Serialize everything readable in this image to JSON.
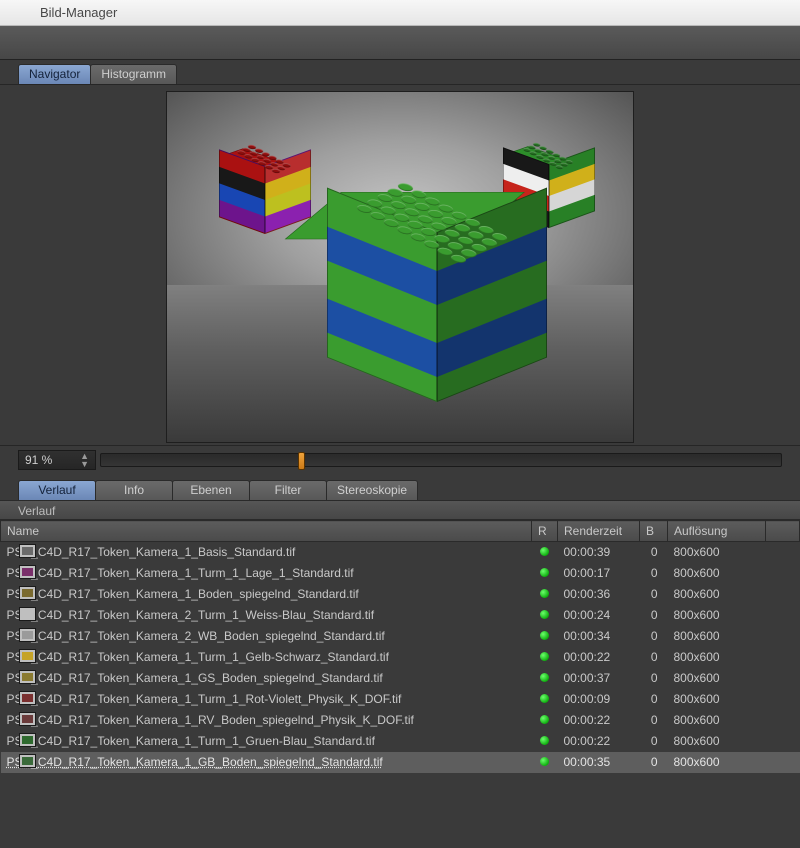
{
  "window": {
    "title": "Bild-Manager"
  },
  "viewer": {
    "tabs": [
      {
        "label": "Navigator",
        "active": true
      },
      {
        "label": "Histogramm",
        "active": false
      }
    ],
    "zoom_value": "91 %",
    "slider_pos_pct": 29
  },
  "history": {
    "tabs": [
      {
        "label": "Verlauf",
        "active": true
      },
      {
        "label": "Info",
        "active": false
      },
      {
        "label": "Ebenen",
        "active": false
      },
      {
        "label": "Filter",
        "active": false
      },
      {
        "label": "Stereoskopie",
        "active": false
      }
    ],
    "section_title": "Verlauf",
    "columns": {
      "name": "Name",
      "r": "R",
      "time": "Renderzeit",
      "b": "B",
      "res": "Auflösung"
    },
    "rows": [
      {
        "icon": "#6a6a6a",
        "name": "PSD_C4D_R17_Token_Kamera_1_Basis_Standard.tif",
        "time": "00:00:39",
        "b": "0",
        "res": "800x600"
      },
      {
        "icon": "#7a2f6a",
        "name": "PSD_C4D_R17_Token_Kamera_1_Turm_1_Lage_1_Standard.tif",
        "time": "00:00:17",
        "b": "0",
        "res": "800x600"
      },
      {
        "icon": "#7a6a2f",
        "name": "PSD_C4D_R17_Token_Kamera_1_Boden_spiegelnd_Standard.tif",
        "time": "00:00:36",
        "b": "0",
        "res": "800x600"
      },
      {
        "icon": "#bfbfbf",
        "name": "PSD_C4D_R17_Token_Kamera_2_Turm_1_Weiss-Blau_Standard.tif",
        "time": "00:00:24",
        "b": "0",
        "res": "800x600"
      },
      {
        "icon": "#9a9a9a",
        "name": "PSD_C4D_R17_Token_Kamera_2_WB_Boden_spiegelnd_Standard.tif",
        "time": "00:00:34",
        "b": "0",
        "res": "800x600"
      },
      {
        "icon": "#c5a327",
        "name": "PSD_C4D_R17_Token_Kamera_1_Turm_1_Gelb-Schwarz_Standard.tif",
        "time": "00:00:22",
        "b": "0",
        "res": "800x600"
      },
      {
        "icon": "#8a7a30",
        "name": "PSD_C4D_R17_Token_Kamera_1_GS_Boden_spiegelnd_Standard.tif",
        "time": "00:00:37",
        "b": "0",
        "res": "800x600"
      },
      {
        "icon": "#7a2f2f",
        "name": "PSD_C4D_R17_Token_Kamera_1_Turm_1_Rot-Violett_Physik_K_DOF.tif",
        "time": "00:00:09",
        "b": "0",
        "res": "800x600"
      },
      {
        "icon": "#6a3a3a",
        "name": "PSD_C4D_R17_Token_Kamera_1_RV_Boden_spiegelnd_Physik_K_DOF.tif",
        "time": "00:00:22",
        "b": "0",
        "res": "800x600"
      },
      {
        "icon": "#2f6a2f",
        "name": "PSD_C4D_R17_Token_Kamera_1_Turm_1_Gruen-Blau_Standard.tif",
        "time": "00:00:22",
        "b": "0",
        "res": "800x600"
      },
      {
        "icon": "#3a6a3a",
        "name": "PSD_C4D_R17_Token_Kamera_1_GB_Boden_spiegelnd_Standard.tif",
        "time": "00:00:35",
        "b": "0",
        "res": "800x600",
        "selected": true
      }
    ]
  }
}
